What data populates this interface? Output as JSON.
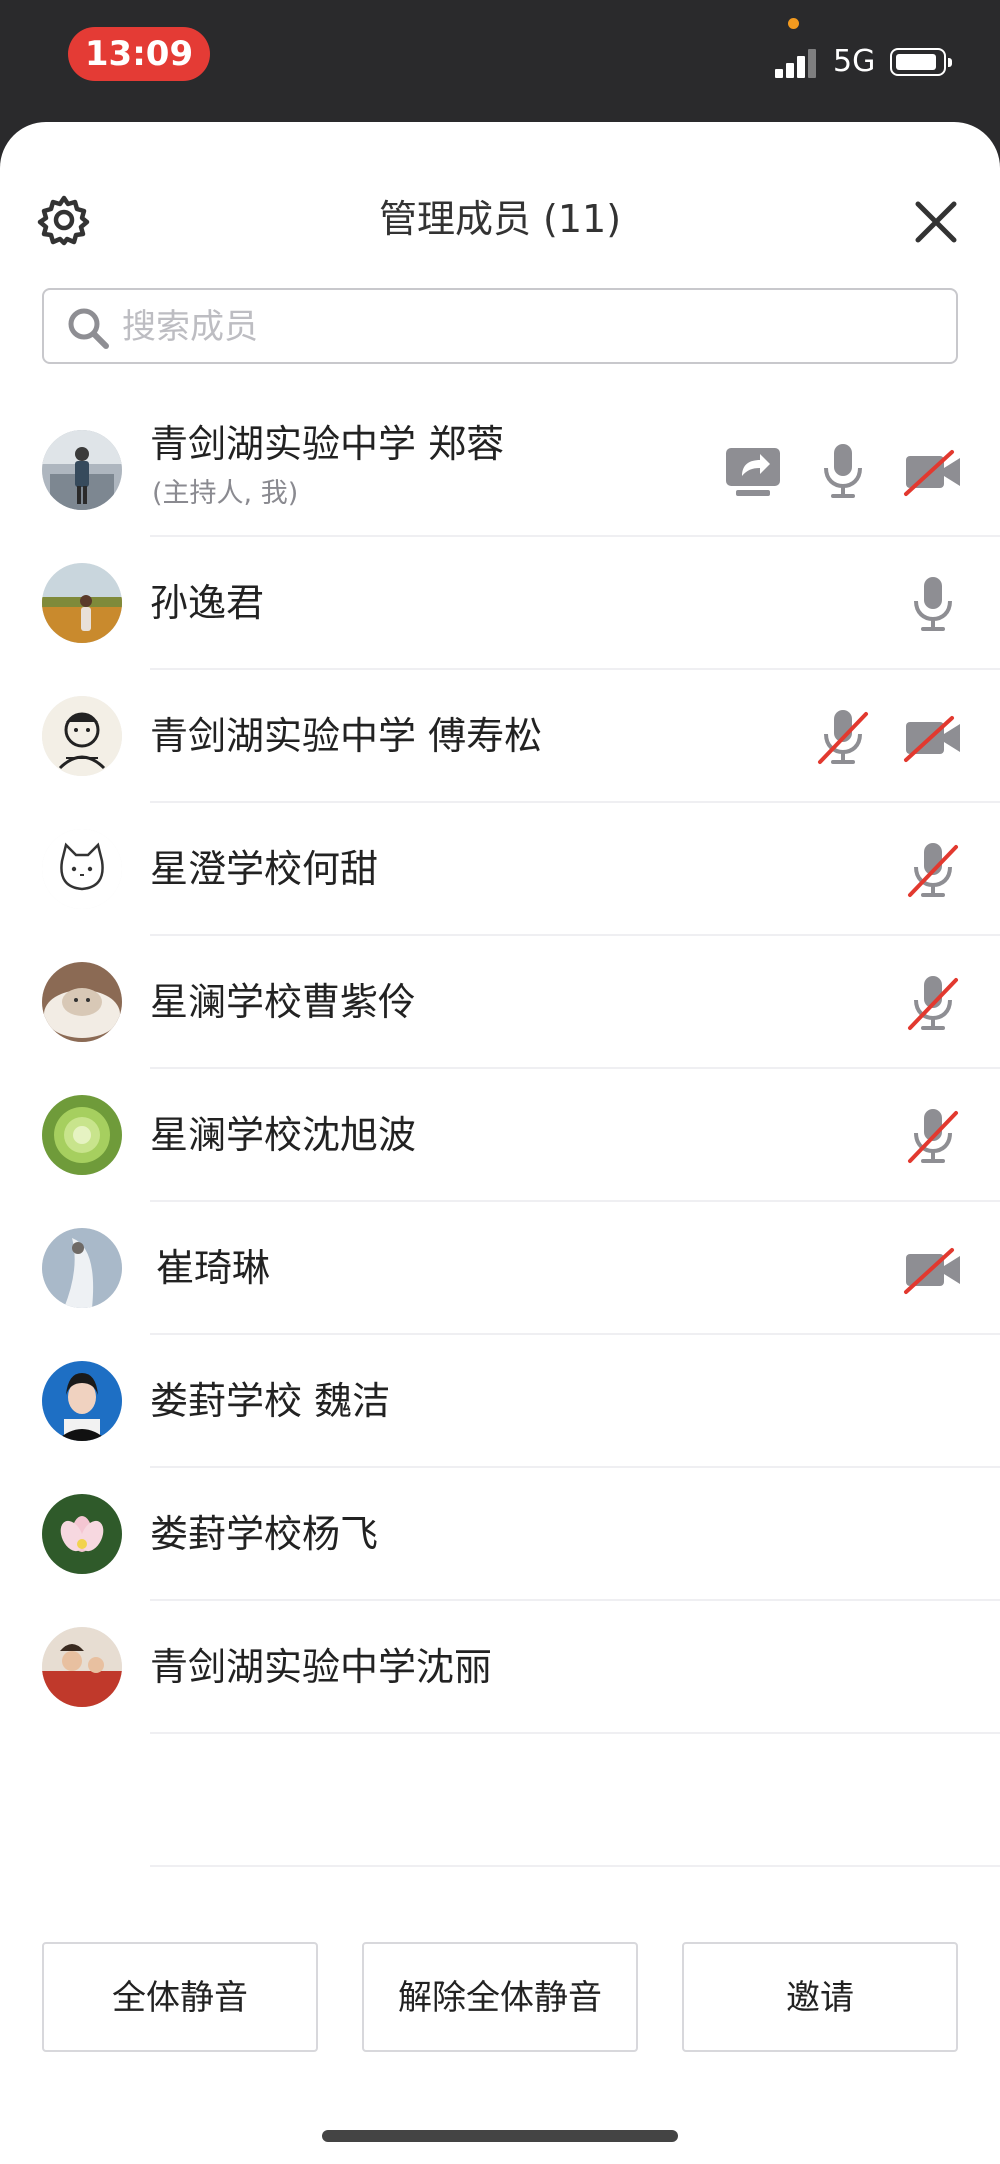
{
  "status_bar": {
    "time": "13:09",
    "network": "5G"
  },
  "header": {
    "title": "管理成员 (11)"
  },
  "search": {
    "placeholder": "搜索成员"
  },
  "members": [
    {
      "name": "青剑湖实验中学 郑蓉",
      "sub": "(主持人, 我)",
      "share_screen": true,
      "mic": "on",
      "camera": "off"
    },
    {
      "name": "孙逸君",
      "mic": "on"
    },
    {
      "name": "青剑湖实验中学 傅寿松",
      "mic": "off",
      "camera": "off"
    },
    {
      "name": "星澄学校何甜",
      "mic": "off"
    },
    {
      "name": "星澜学校曹紫伶",
      "mic": "off"
    },
    {
      "name": "星澜学校沈旭波",
      "mic": "off"
    },
    {
      "name": "崔琦琳",
      "camera": "off"
    },
    {
      "name": "娄葑学校 魏洁"
    },
    {
      "name": "娄葑学校杨飞"
    },
    {
      "name": "青剑湖实验中学沈丽"
    }
  ],
  "footer": {
    "mute_all": "全体静音",
    "unmute_all": "解除全体静音",
    "invite": "邀请"
  },
  "colors": {
    "accent_red": "#e43b35",
    "icon_gray": "#8e8e93",
    "muted_red": "#e2392f"
  }
}
